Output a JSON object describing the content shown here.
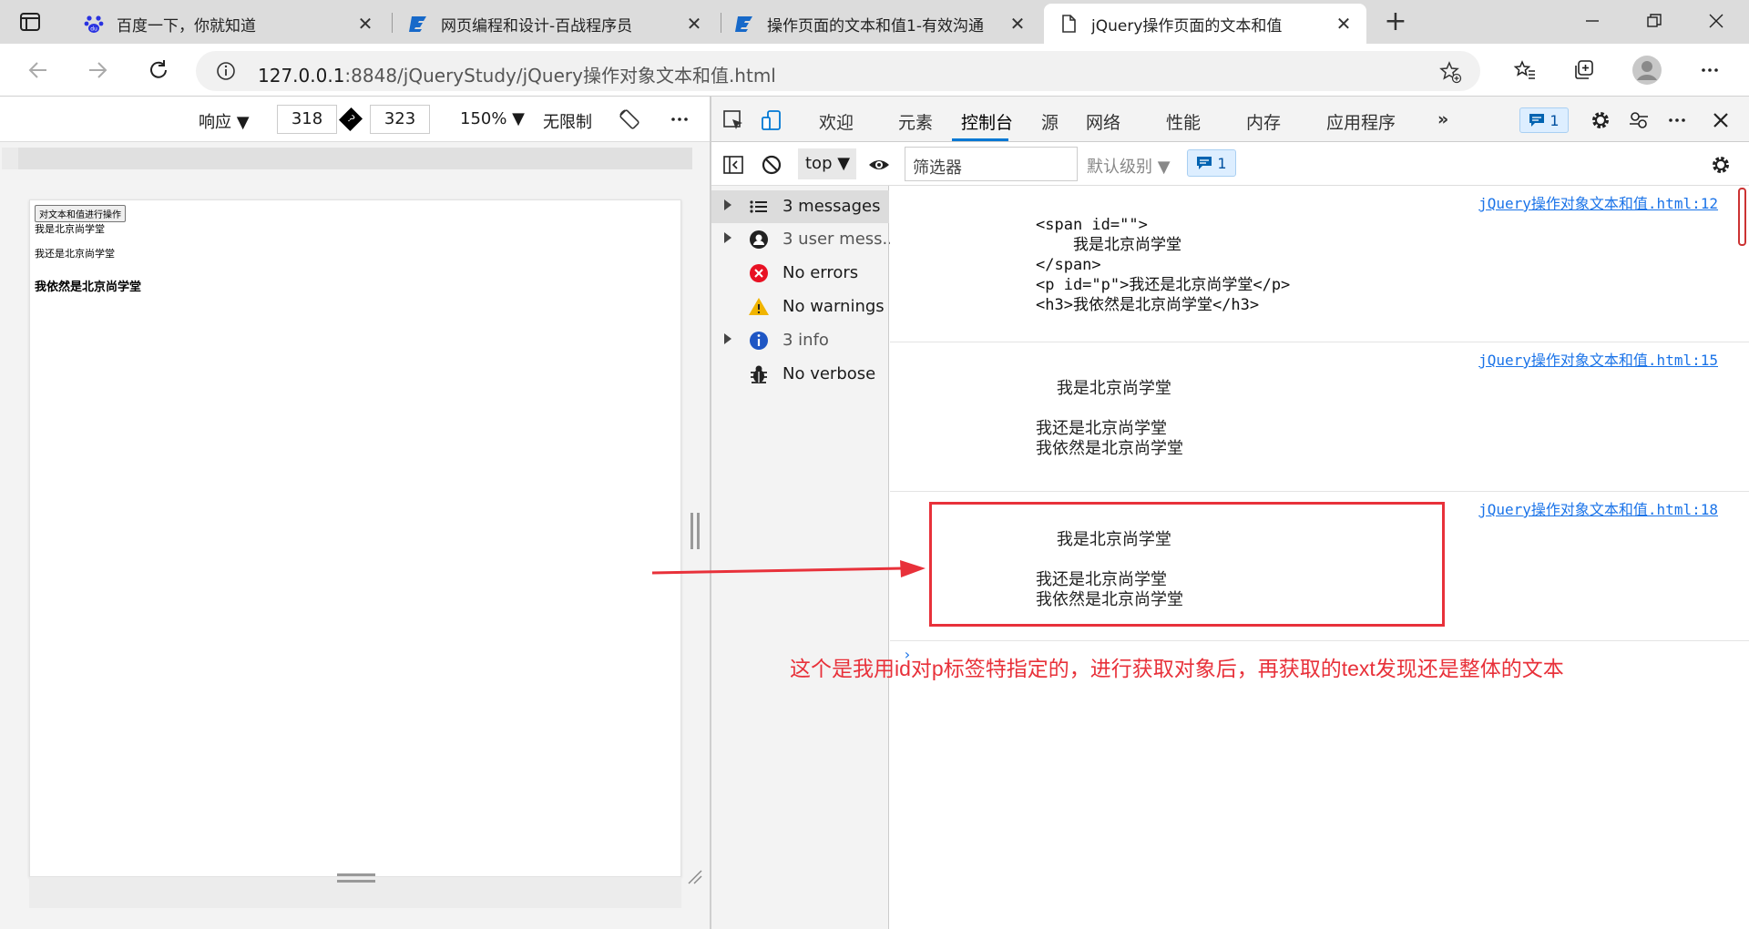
{
  "browser": {
    "tabs": [
      {
        "title": "百度一下，你就知道",
        "icon": "baidu-paw-icon",
        "active": false
      },
      {
        "title": "网页编程和设计-百战程序员",
        "icon": "bz-logo-icon",
        "active": false
      },
      {
        "title": "操作页面的文本和值1-有效沟通",
        "icon": "bz-logo-icon",
        "active": false
      },
      {
        "title": "jQuery操作页面的文本和值",
        "icon": "page-icon",
        "active": true
      }
    ],
    "new_tab": "+",
    "url_host": "127.0.0.1",
    "url_rest": ":8848/jQueryStudy/jQuery操作对象文本和值.html"
  },
  "emulation": {
    "mode": "响应 ▼",
    "width": "318",
    "height": "323",
    "zoom": "150% ▼",
    "throttle": "无限制"
  },
  "page": {
    "button_label": "对文本和值进行操作",
    "span_text": "我是北京尚学堂",
    "p_text": "我还是北京尚学堂",
    "h3_text": "我依然是北京尚学堂"
  },
  "devtools": {
    "tabs": [
      "欢迎",
      "元素",
      "控制台",
      "源",
      "网络",
      "性能",
      "内存",
      "应用程序"
    ],
    "active_tab": "控制台",
    "more": "»",
    "issues_count": "1"
  },
  "console_toolbar": {
    "context": "top ▼",
    "filter_placeholder": "筛选器",
    "level": "默认级别 ▼",
    "issues_count": "1"
  },
  "sidebar": {
    "items": [
      {
        "label": "3 messages",
        "icon": "list-icon",
        "expandable": true,
        "selected": true
      },
      {
        "label": "3 user mess...",
        "icon": "user-icon",
        "expandable": true,
        "selected": false
      },
      {
        "label": "No errors",
        "icon": "error-icon",
        "expandable": false,
        "selected": false
      },
      {
        "label": "No warnings",
        "icon": "warning-icon",
        "expandable": false,
        "selected": false
      },
      {
        "label": "3 info",
        "icon": "info-icon",
        "expandable": true,
        "selected": false
      },
      {
        "label": "No verbose",
        "icon": "bug-icon",
        "expandable": false,
        "selected": false
      }
    ]
  },
  "console": {
    "messages": [
      {
        "source": "jQuery操作对象文本和值.html:12",
        "text": "<span id=\"\">\n    我是北京尚学堂\n</span>\n<p id=\"p\">我还是北京尚学堂</p>\n<h3>我依然是北京尚学堂</h3>"
      },
      {
        "source": "jQuery操作对象文本和值.html:15",
        "text": "    我是北京尚学堂\n\n我还是北京尚学堂\n我依然是北京尚学堂"
      },
      {
        "source": "jQuery操作对象文本和值.html:18",
        "text": "    我是北京尚学堂\n\n我还是北京尚学堂\n我依然是北京尚学堂"
      }
    ],
    "prompt": "›"
  },
  "annotation": {
    "text": "这个是我用id对p标签特指定的，进行获取对象后，再获取的text发现还是整体的文本",
    "color": "#e8313a"
  },
  "colors": {
    "accent": "#0078d4",
    "link": "#1a73e8",
    "annotation_red": "#e8313a"
  }
}
